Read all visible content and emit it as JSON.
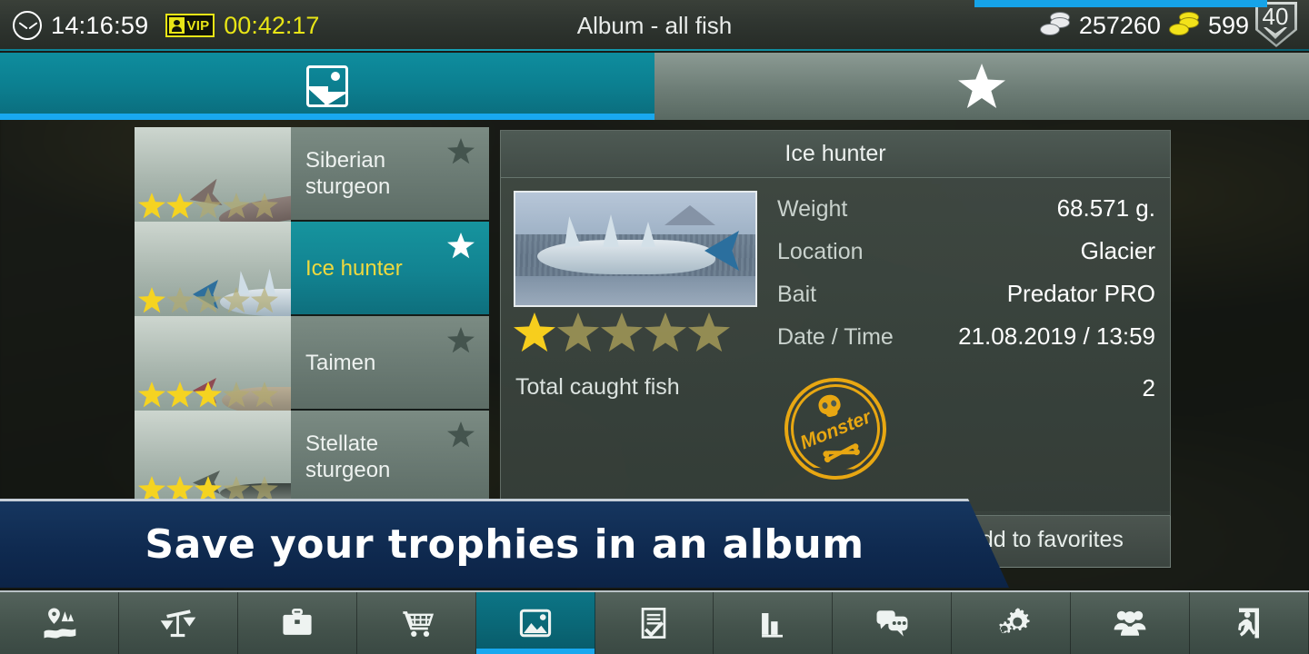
{
  "status_bar": {
    "clock_icon": "clock-icon",
    "time": "14:16:59",
    "vip_label": "VIP",
    "vip_time": "00:42:17",
    "title": "Album - all fish",
    "silver_coins": "257260",
    "gold_coins": "599",
    "level": "40"
  },
  "tabs": [
    {
      "name": "album",
      "icon": "photo-icon",
      "active": true
    },
    {
      "name": "favorites",
      "icon": "star-icon",
      "active": false
    }
  ],
  "fish_list": [
    {
      "name": "Siberian sturgeon",
      "stars_filled": 2,
      "stars_total": 5,
      "favorite": false,
      "selected": false,
      "fish_art": "f-sturgeon"
    },
    {
      "name": "Ice hunter",
      "stars_filled": 1,
      "stars_total": 5,
      "favorite": true,
      "selected": true,
      "fish_art": "f-ice"
    },
    {
      "name": "Taimen",
      "stars_filled": 3,
      "stars_total": 5,
      "favorite": false,
      "selected": false,
      "fish_art": "f-taimen"
    },
    {
      "name": "Stellate sturgeon",
      "stars_filled": 3,
      "stars_total": 5,
      "favorite": false,
      "selected": false,
      "fish_art": "f-stellate"
    }
  ],
  "detail": {
    "title": "Ice hunter",
    "stars_filled": 1,
    "stars_total": 5,
    "rows": [
      {
        "key": "Weight",
        "value": "68.571 g."
      },
      {
        "key": "Location",
        "value": "Glacier"
      },
      {
        "key": "Bait",
        "value": "Predator PRO"
      },
      {
        "key": "Date / Time",
        "value": "21.08.2019 / 13:59"
      }
    ],
    "total_label": "Total caught fish",
    "total_value": "2",
    "badge": "Monster",
    "favorites_button": "Add to favorites"
  },
  "promo": {
    "text": "Save your trophies in an album"
  },
  "bottom_nav": [
    {
      "name": "map",
      "icon": "map-pin-icon",
      "active": false
    },
    {
      "name": "records",
      "icon": "scales-icon",
      "active": false
    },
    {
      "name": "inventory",
      "icon": "briefcase-icon",
      "active": false
    },
    {
      "name": "shop",
      "icon": "cart-icon",
      "active": false
    },
    {
      "name": "album",
      "icon": "photo-icon",
      "active": true
    },
    {
      "name": "tasks",
      "icon": "checklist-icon",
      "active": false
    },
    {
      "name": "stats",
      "icon": "bar-chart-icon",
      "active": false
    },
    {
      "name": "chat",
      "icon": "chat-icon",
      "active": false
    },
    {
      "name": "settings",
      "icon": "gears-icon",
      "active": false
    },
    {
      "name": "friends",
      "icon": "people-icon",
      "active": false
    },
    {
      "name": "exit",
      "icon": "exit-icon",
      "active": false
    }
  ],
  "colors": {
    "accent_teal": "#0c7f90",
    "accent_blue": "#19a8ef",
    "star_gold": "#f5d321",
    "badge_gold": "#e8a712",
    "ribbon_navy": "#0f2a50",
    "vip_yellow": "#e8e516"
  }
}
